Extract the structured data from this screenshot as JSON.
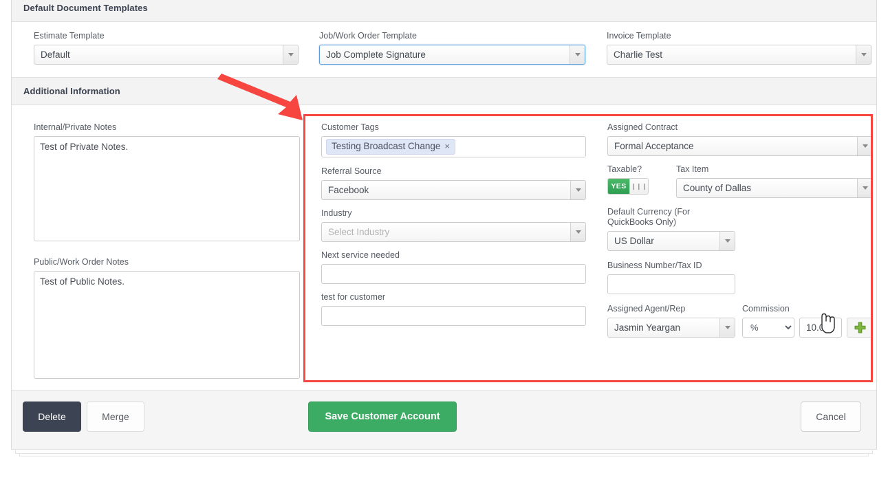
{
  "sections": {
    "templates_title": "Default Document Templates",
    "additional_title": "Additional Information"
  },
  "templates": {
    "estimate": {
      "label": "Estimate Template",
      "value": "Default"
    },
    "job": {
      "label": "Job/Work Order Template",
      "value": "Job Complete Signature"
    },
    "invoice": {
      "label": "Invoice Template",
      "value": "Charlie Test"
    }
  },
  "notes": {
    "private": {
      "label": "Internal/Private Notes",
      "value": "Test of Private Notes."
    },
    "public": {
      "label": "Public/Work Order Notes",
      "value": "Test of Public Notes."
    }
  },
  "middle": {
    "customer_tags": {
      "label": "Customer Tags",
      "tag": "Testing Broadcast Change",
      "remove": "×"
    },
    "referral_source": {
      "label": "Referral Source",
      "value": "Facebook"
    },
    "industry": {
      "label": "Industry",
      "placeholder": "Select Industry"
    },
    "next_service": {
      "label": "Next service needed",
      "value": ""
    },
    "test_for_customer": {
      "label": "test for customer",
      "value": ""
    }
  },
  "right": {
    "assigned_contract": {
      "label": "Assigned Contract",
      "value": "Formal Acceptance"
    },
    "taxable": {
      "label": "Taxable?",
      "state": "YES",
      "knob": "❙❙❙"
    },
    "tax_item": {
      "label": "Tax Item",
      "value": "County of Dallas"
    },
    "currency": {
      "label_line1": "Default Currency (For",
      "label_line2": "QuickBooks Only)",
      "value": "US Dollar"
    },
    "business_number": {
      "label": "Business Number/Tax ID",
      "value": ""
    },
    "agent": {
      "label": "Assigned Agent/Rep",
      "value": "Jasmin Yeargan"
    },
    "commission": {
      "label": "Commission",
      "unit": "%",
      "unit_options": [
        "%",
        "$"
      ],
      "amount": "10.00",
      "add": "+"
    }
  },
  "footer": {
    "delete": "Delete",
    "merge": "Merge",
    "save": "Save Customer Account",
    "cancel": "Cancel"
  },
  "colors": {
    "accent_green": "#3cab63",
    "toggle_green": "#2f9e50",
    "annotation_red": "#f74640",
    "dark_button": "#3c4352",
    "focus_blue": "#5b9dd9",
    "tag_blue": "#dfe6f6"
  }
}
